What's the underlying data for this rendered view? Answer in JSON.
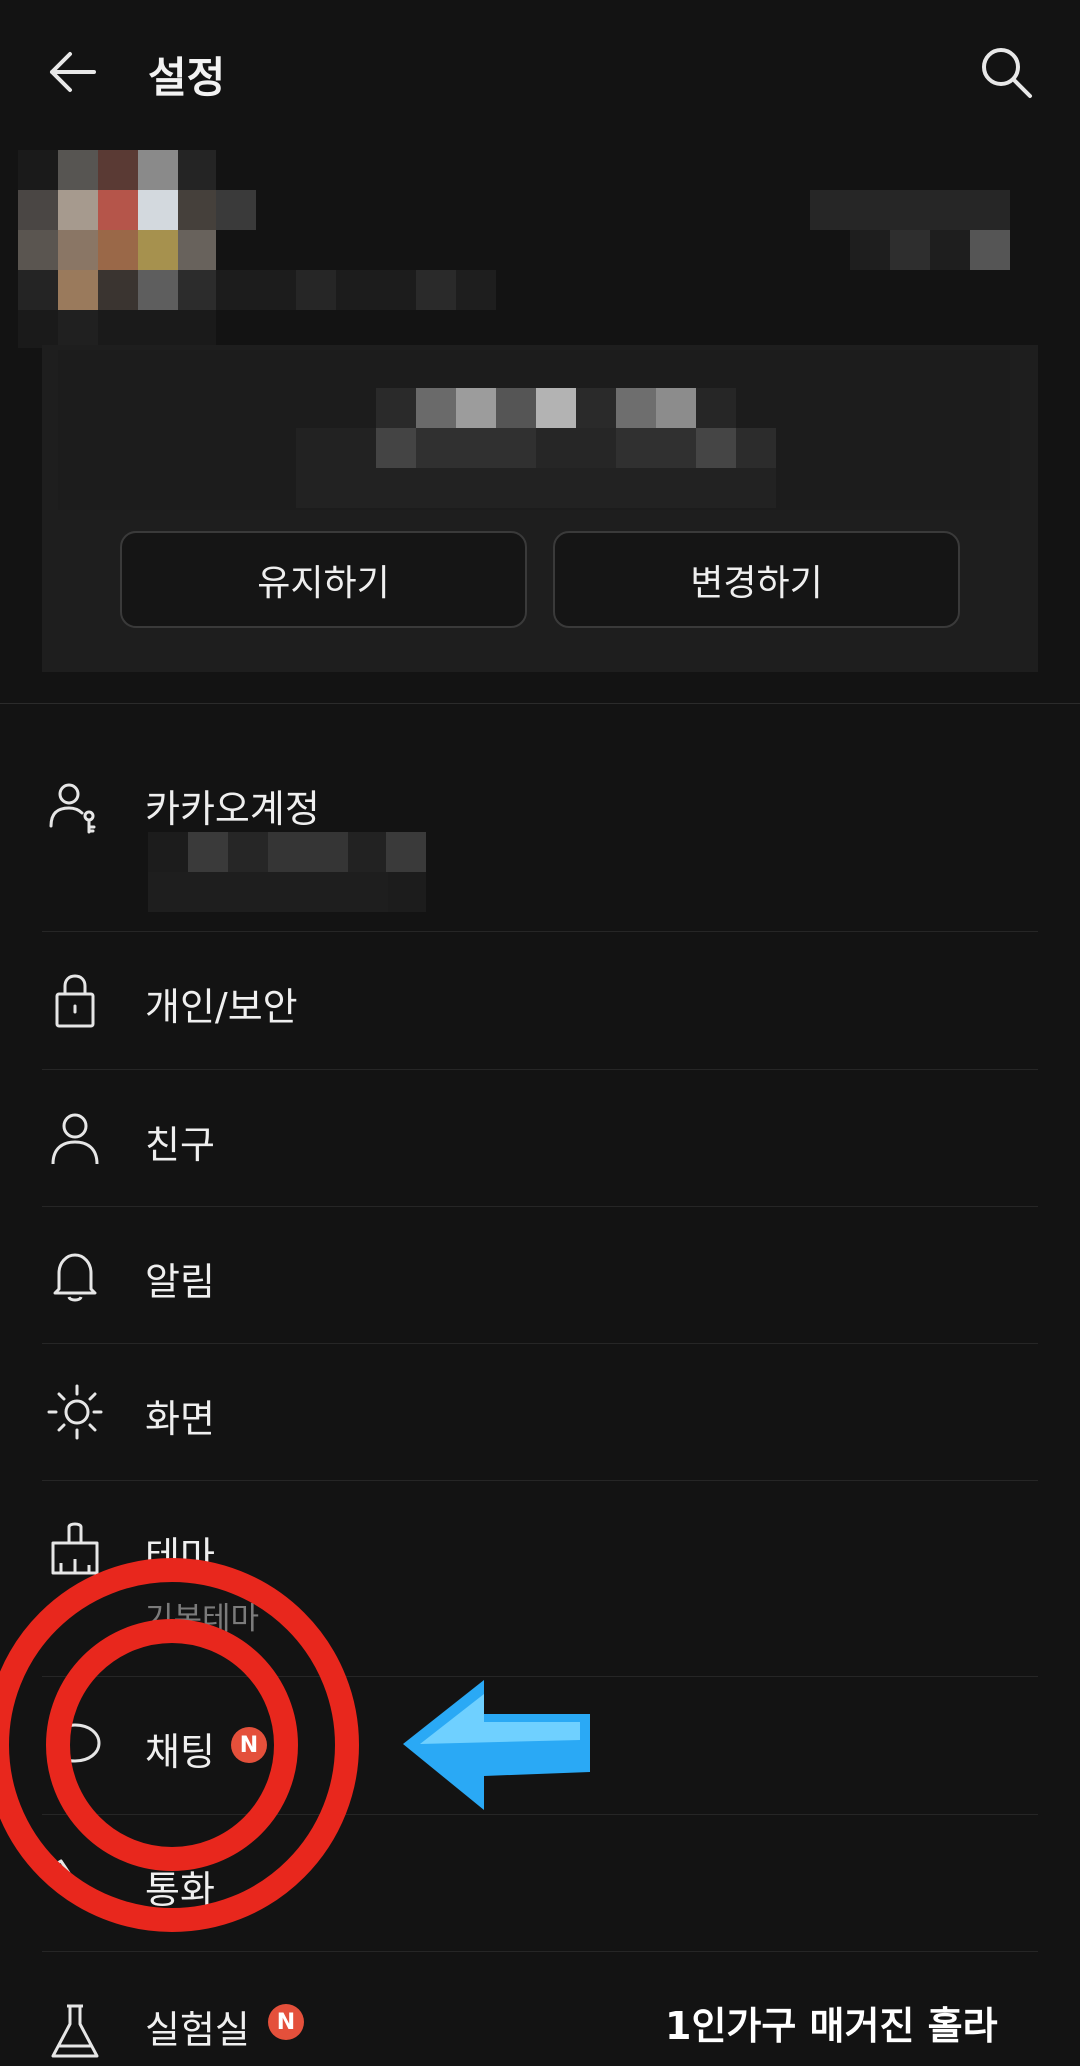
{
  "header": {
    "title": "설정"
  },
  "profile": {
    "keep_label": "유지하기",
    "change_label": "변경하기"
  },
  "menu": [
    {
      "label": "카카오계정",
      "icon": "account-icon"
    },
    {
      "label": "개인/보안",
      "icon": "lock-icon"
    },
    {
      "label": "친구",
      "icon": "person-icon"
    },
    {
      "label": "알림",
      "icon": "bell-icon"
    },
    {
      "label": "화면",
      "icon": "brightness-icon"
    },
    {
      "label": "테마",
      "sub": "기본테마",
      "icon": "theme-brush-icon"
    },
    {
      "label": "채팅",
      "badge": "N",
      "icon": "chat-bubble-icon"
    },
    {
      "label": "통화",
      "icon": "phone-icon"
    },
    {
      "label": "실험실",
      "badge": "N",
      "icon": "flask-icon"
    }
  ],
  "watermark": "1인가구 매거진 홀라",
  "colors": {
    "background": "#131313",
    "badge": "#e4503b",
    "annotation_circle": "#e8271d",
    "annotation_arrow": "#2aa9f5"
  }
}
